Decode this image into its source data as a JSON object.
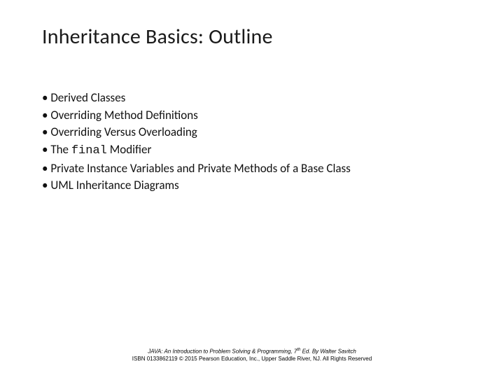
{
  "title": "Inheritance Basics: Outline",
  "bullets": {
    "b0": "Derived Classes",
    "b1": "Overriding Method Definitions",
    "b2": "Overriding Versus Overloading",
    "b3_pre": "The ",
    "b3_code": "final",
    "b3_post": " Modifier",
    "b4": "Private Instance Variables and Private Methods of a Base Class",
    "b5": "UML Inheritance Diagrams"
  },
  "footer": {
    "book": "JAVA: An Introduction to Problem Solving & Programming",
    "edition_pre": ", 7",
    "edition_sup": "th",
    "author": " Ed. By Walter Savitch",
    "line2": "ISBN 0133862119 © 2015 Pearson Education, Inc., Upper Saddle River, NJ. All Rights Reserved"
  }
}
